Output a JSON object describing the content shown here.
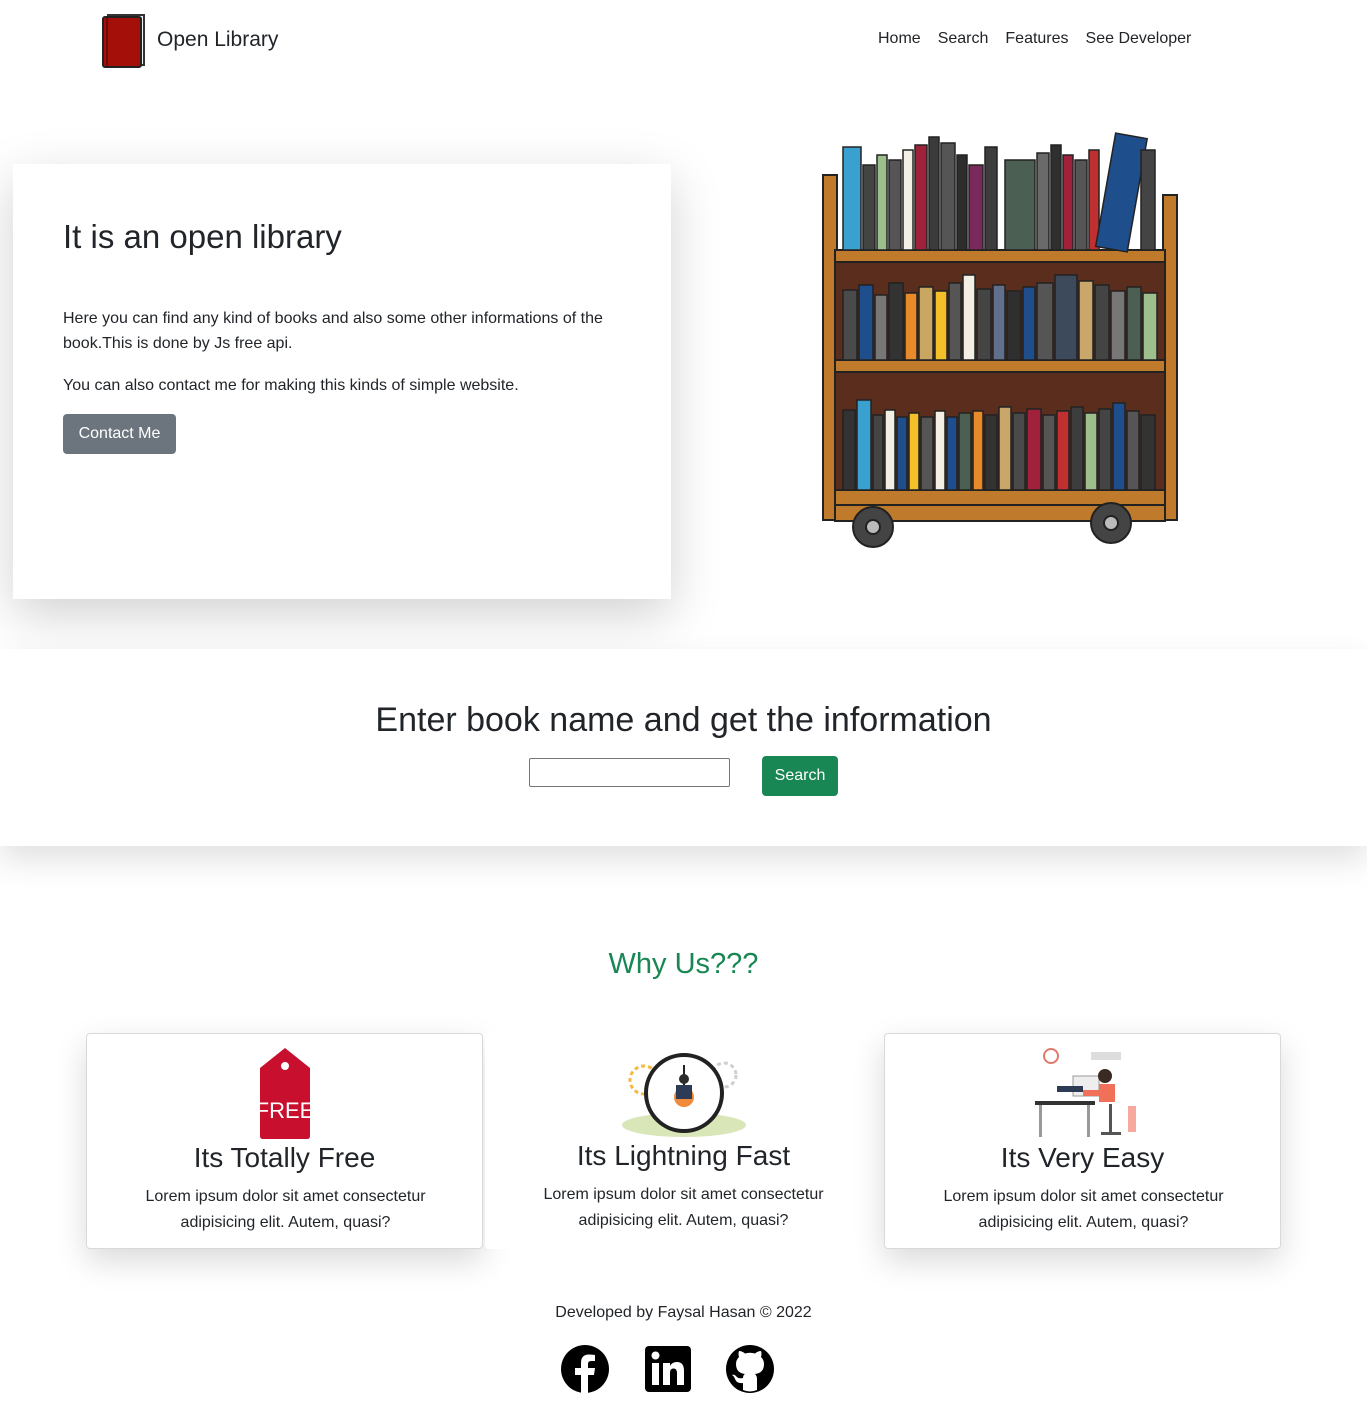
{
  "navbar": {
    "brand": "Open Library",
    "links": [
      "Home",
      "Search",
      "Features",
      "See Developer"
    ]
  },
  "hero": {
    "title": "It is an open library",
    "paragraph1": "Here you can find any kind of books and also some other informations of the book.This is done by Js free api.",
    "paragraph2": "You can also contact me for making this kinds of simple website.",
    "button": "Contact Me"
  },
  "search": {
    "title": "Enter book name and get the information",
    "input_value": "",
    "button": "Search"
  },
  "why": {
    "title": "Why Us???",
    "cards": [
      {
        "title": "Its Totally Free",
        "text": "Lorem ipsum dolor sit amet consectetur adipisicing elit. Autem, quasi?",
        "badge": "FREE"
      },
      {
        "title": "Its Lightning Fast",
        "text": "Lorem ipsum dolor sit amet consectetur adipisicing elit. Autem, quasi?"
      },
      {
        "title": "Its Very Easy",
        "text": "Lorem ipsum dolor sit amet consectetur adipisicing elit. Autem, quasi?"
      }
    ]
  },
  "footer": {
    "text": "Developed by Faysal Hasan © 2022",
    "social": [
      "facebook-icon",
      "linkedin-icon",
      "github-icon"
    ]
  },
  "colors": {
    "primary_green": "#198754",
    "secondary_gray": "#6c757d",
    "book_red": "#a50f0a"
  }
}
